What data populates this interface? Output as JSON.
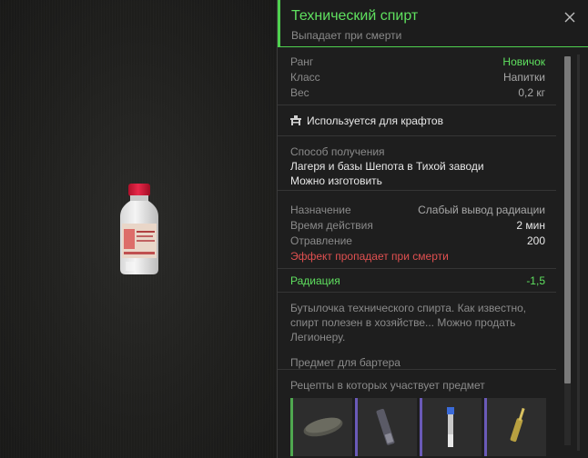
{
  "item": {
    "title": "Технический спирт",
    "subtitle": "Выпадает при смерти",
    "accent_color": "#5fe05f"
  },
  "stats": [
    {
      "label": "Ранг",
      "value": "Новичок",
      "highlight": "green"
    },
    {
      "label": "Класс",
      "value": "Напитки"
    },
    {
      "label": "Вес",
      "value": "0,2 кг"
    }
  ],
  "craft": {
    "icon": "workbench-icon",
    "label": "Используется для крафтов"
  },
  "obtain": {
    "label": "Способ получения",
    "lines": [
      "Лагеря и базы Шепота в Тихой заводи",
      "Можно изготовить"
    ]
  },
  "effects": [
    {
      "label": "Назначение",
      "value": "Слабый вывод радиации"
    },
    {
      "label": "Время действия",
      "value": "2 мин"
    },
    {
      "label": "Отравление",
      "value": "200"
    }
  ],
  "effect_warning": "Эффект пропадает при смерти",
  "radiation": {
    "label": "Радиация",
    "value": "-1,5"
  },
  "description": "Бутылочка технического спирта. Как известно, спирт полезен в хозяйстве... Можно продать Легионеру.",
  "barter_label": "Предмет для бартера",
  "recipes": {
    "label": "Рецепты в которых участвует предмет",
    "items": [
      {
        "icon": "soap-bar-icon",
        "bar_color": "#4fa84f"
      },
      {
        "icon": "syringe-icon",
        "bar_color": "#6a5ab8"
      },
      {
        "icon": "vial-icon",
        "bar_color": "#6a5ab8"
      },
      {
        "icon": "ampoule-icon",
        "bar_color": "#6a5ab8"
      }
    ]
  }
}
